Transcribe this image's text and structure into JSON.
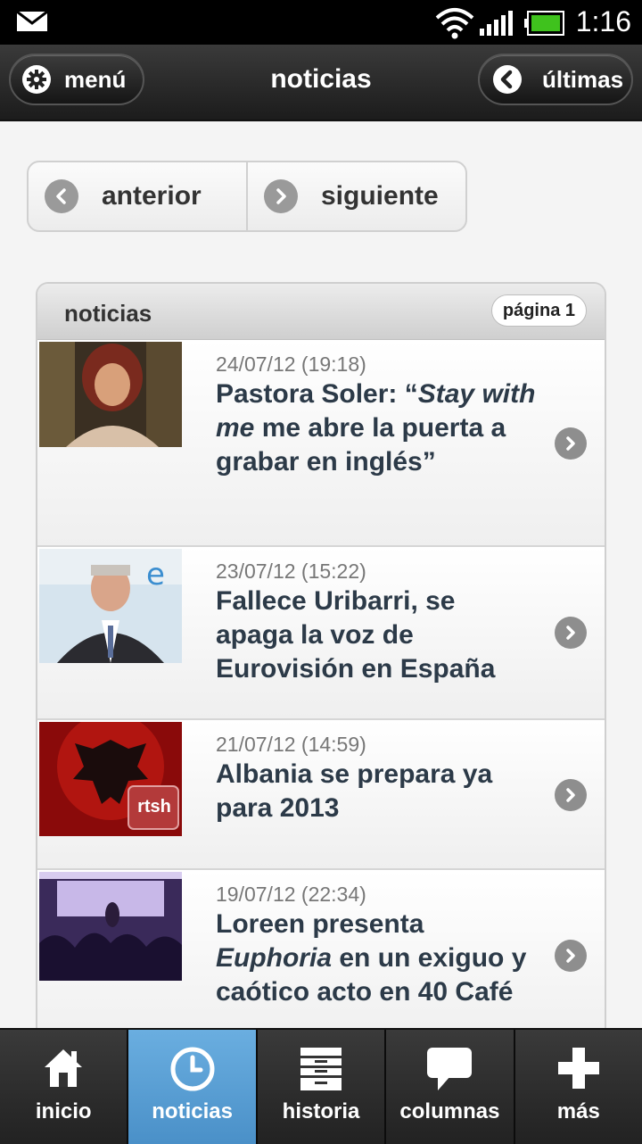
{
  "status_bar": {
    "time": "1:16",
    "icons": [
      "mail-icon",
      "wifi-icon",
      "signal-icon",
      "battery-icon"
    ]
  },
  "header": {
    "title": "noticias",
    "menu_label": "menú",
    "latest_label": "últimas"
  },
  "pager": {
    "prev_label": "anterior",
    "next_label": "siguiente"
  },
  "list": {
    "title": "noticias",
    "page_badge": "página 1",
    "items": [
      {
        "date": "24/07/12 (19:18)",
        "title": "Pastora Soler: “Stay with me me abre la puerta a grabar en inglés”",
        "title_parts": [
          "Pastora Soler: “",
          "Stay with me",
          " me abre la puerta a grabar en inglés”"
        ]
      },
      {
        "date": "23/07/12 (15:22)",
        "title": "Fallece Uribarri, se apaga la voz de Eurovisión en España"
      },
      {
        "date": "21/07/12 (14:59)",
        "title": "Albania se prepara ya para 2013",
        "thumb_text": "rtsh"
      },
      {
        "date": "19/07/12 (22:34)",
        "title": "Loreen presenta Euphoria en un exiguo y caótico acto en 40 Café",
        "title_parts": [
          "Loreen presenta ",
          "Euphoria",
          " en un exiguo y caótico acto en 40 Café"
        ]
      }
    ]
  },
  "tabs": [
    {
      "label": "inicio",
      "icon": "home-icon",
      "active": false
    },
    {
      "label": "noticias",
      "icon": "clock-icon",
      "active": true
    },
    {
      "label": "historia",
      "icon": "cabinet-icon",
      "active": false
    },
    {
      "label": "columnas",
      "icon": "speech-bubble-icon",
      "active": false
    },
    {
      "label": "más",
      "icon": "plus-icon",
      "active": false
    }
  ],
  "colors": {
    "active_tab": "#4a90c8",
    "title_text": "#2c3a48",
    "header_bg": "#1c1c1c"
  }
}
